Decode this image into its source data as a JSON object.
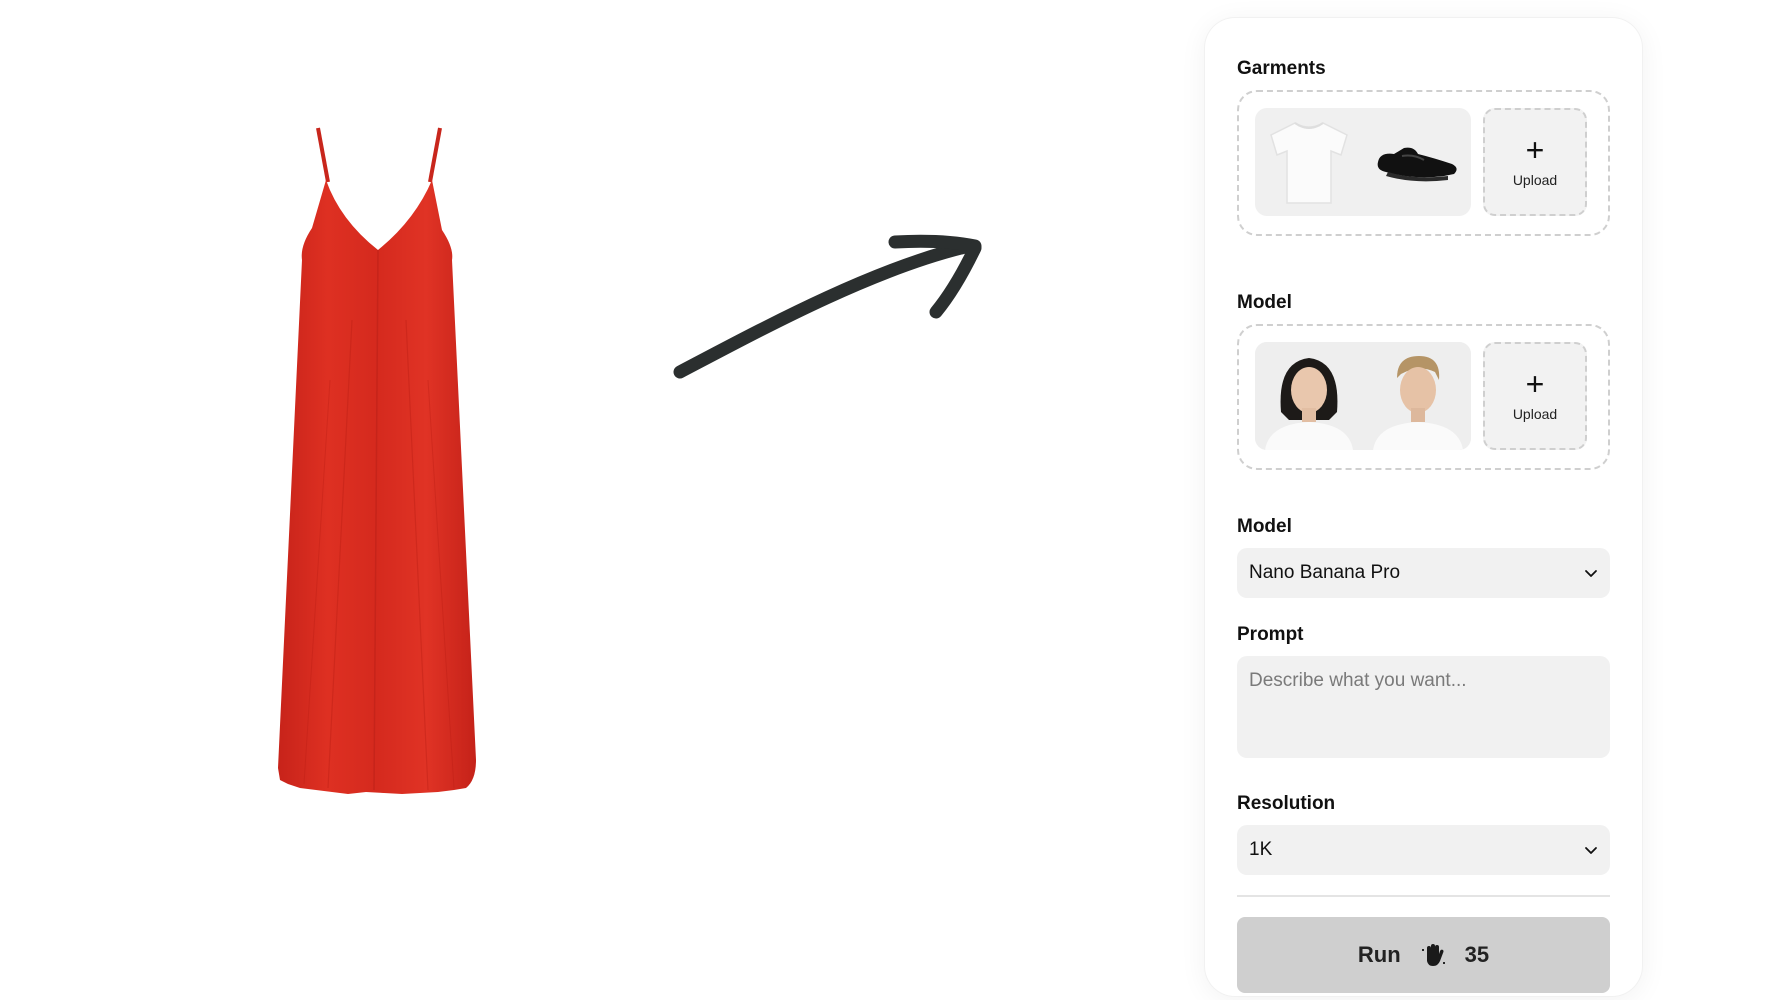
{
  "garments": {
    "label": "Garments",
    "items": [
      {
        "name": "white t-shirt"
      },
      {
        "name": "black loafers"
      }
    ],
    "upload_label": "Upload"
  },
  "models": {
    "label": "Model",
    "items": [
      {
        "name": "female model"
      },
      {
        "name": "male model"
      }
    ],
    "upload_label": "Upload"
  },
  "model_select": {
    "label": "Model",
    "value": "Nano Banana Pro"
  },
  "prompt": {
    "label": "Prompt",
    "placeholder": "Describe what you want..."
  },
  "resolution": {
    "label": "Resolution",
    "value": "1K"
  },
  "run": {
    "label": "Run",
    "cost": "35"
  },
  "colors": {
    "dress": "#d52a1e",
    "arrow": "#2b2f2f",
    "run_bg": "#cfcfcf",
    "field_bg": "#f1f1f1"
  }
}
